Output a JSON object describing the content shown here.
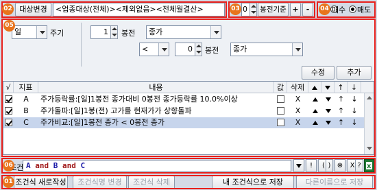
{
  "badges": [
    "02",
    "03",
    "04",
    "05",
    "06",
    "01"
  ],
  "top": {
    "target_change_label": "대상변경",
    "target_text": "<업종대상(전체)><제외없음><전체월결산>",
    "bong_value": "0",
    "bong_base_label": "봉전기준",
    "plus_label": "+",
    "minus_label": "-",
    "buy_label": "매수",
    "sell_label": "매도",
    "selected_side": "sell"
  },
  "condition": {
    "period_value": "일",
    "cycle_label": "주기",
    "n_bong_value": "1",
    "bong_label": "봉전",
    "price_value": "종가",
    "operator_value": "<",
    "n_bong2_value": "0",
    "bong2_label": "봉전",
    "price2_value": "종가",
    "modify_label": "수정",
    "add_label": "추가"
  },
  "table": {
    "headers": [
      "√",
      "지표",
      "내용",
      "값",
      "삭제",
      "▲",
      "▼",
      "↑",
      "↓"
    ],
    "rows": [
      {
        "checked": true,
        "id": "A",
        "content": "주가등락률:[일]1봉전 종가대비 0봉전 종가등락률 10.0%이상",
        "value_checked": false,
        "delete": "X",
        "selected": false
      },
      {
        "checked": true,
        "id": "B",
        "content": "주가돌파:[일]1봉(전) 고가를 현재가가 상향돌파",
        "value_checked": false,
        "delete": "X",
        "selected": false
      },
      {
        "checked": true,
        "id": "C",
        "content": "주가비교:[일]1봉전 종가 < 0봉전 종가",
        "value_checked": false,
        "delete": "X",
        "selected": true
      }
    ]
  },
  "formula": {
    "label": "조건식",
    "tokens": [
      {
        "text": "A",
        "color": "#1a1aa8"
      },
      {
        "text": " and ",
        "color": "#a01818"
      },
      {
        "text": "B",
        "color": "#1a1aa8"
      },
      {
        "text": " and ",
        "color": "#a01818"
      },
      {
        "text": "C",
        "color": "#1a1aa8"
      }
    ],
    "side_buttons": [
      "!",
      "(",
      ")",
      "⊗",
      "X",
      "?"
    ]
  },
  "bottom": {
    "new_label": "조건식 새로작성",
    "rename_label": "조건식명 변경",
    "delete_label": "조건식 삭제",
    "save_label": "내 조건식으로 저장",
    "save_as_label": "다른이름으로 저장"
  },
  "colors": {
    "accent_red": "#e8201c",
    "badge_orange": "#e8741c",
    "excel_green": "#1f7a35"
  }
}
